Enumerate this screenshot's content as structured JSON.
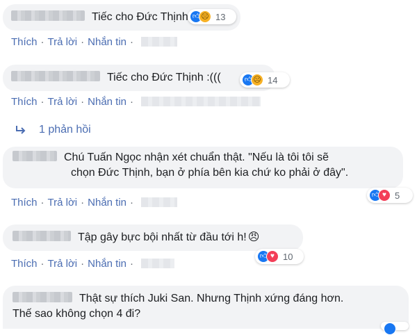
{
  "actions": {
    "like": "Thích",
    "reply": "Trả lời",
    "message": "Nhắn tin",
    "separator": "·"
  },
  "comments": [
    {
      "text": "Tiếc cho Đức Thịnh",
      "reaction_count": "13",
      "reactions": [
        "like-icon",
        "sad-icon"
      ]
    },
    {
      "text": "Tiếc cho Đức Thịnh :(((",
      "reaction_count": "14",
      "reactions": [
        "like-icon",
        "sad-icon"
      ]
    },
    {
      "text_line1": "Chú Tuấn Ngọc nhận xét chuẩn thật. \"Nếu là tôi tôi sẽ",
      "text_line2": "chọn Đức Thịnh, bạn ở phía bên kia chứ ko phải ở đây\".",
      "reaction_count": "5",
      "reactions": [
        "like-icon",
        "love-icon"
      ]
    },
    {
      "text": "Tập gây bực bội nhất từ đầu tới h!",
      "emoji": "😠",
      "reaction_count": "10",
      "reactions": [
        "like-icon",
        "love-icon"
      ]
    },
    {
      "text_line1": "Thật sự thích Juki San. Nhưng Thịnh xứng đáng hơn.",
      "text_line2": "Thế sao không chọn 4 đi?"
    }
  ],
  "reply_link": {
    "label": "1 phản hồi"
  },
  "colors": {
    "link": "#4b6db2",
    "bubble": "#f2f3f5",
    "like": "#1877f2",
    "love": "#f33e58",
    "sad": "#f7b125"
  }
}
